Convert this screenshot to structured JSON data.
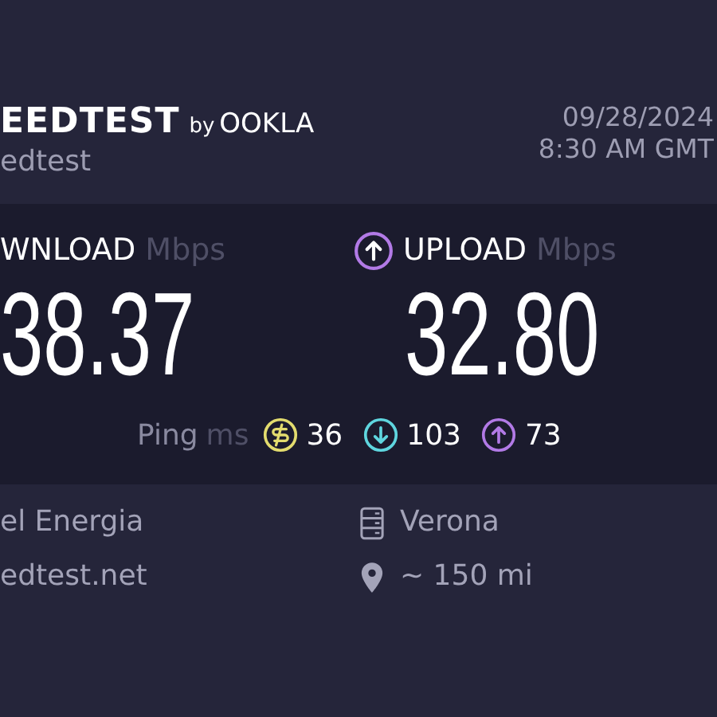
{
  "header": {
    "brand": "EEDTEST",
    "by": "by",
    "logo": "OOKLA",
    "subtitle": "edtest",
    "date": "09/28/2024",
    "time": "8:30 AM GMT"
  },
  "results": [
    {
      "kind": "download",
      "label": "WNLOAD",
      "unit": "Mbps",
      "value": "38.37"
    },
    {
      "kind": "upload",
      "label": "UPLOAD",
      "unit": "Mbps",
      "value": "32.80"
    }
  ],
  "ping": {
    "label": "Ping",
    "unit": "ms",
    "items": [
      {
        "kind": "idle",
        "value": "36"
      },
      {
        "kind": "download",
        "value": "103"
      },
      {
        "kind": "upload",
        "value": "73"
      }
    ]
  },
  "provider": [
    "el Energia",
    "edtest.net"
  ],
  "server": [
    {
      "kind": "server",
      "text": "Verona"
    },
    {
      "kind": "distance",
      "text": "~ 150 mi"
    }
  ]
}
